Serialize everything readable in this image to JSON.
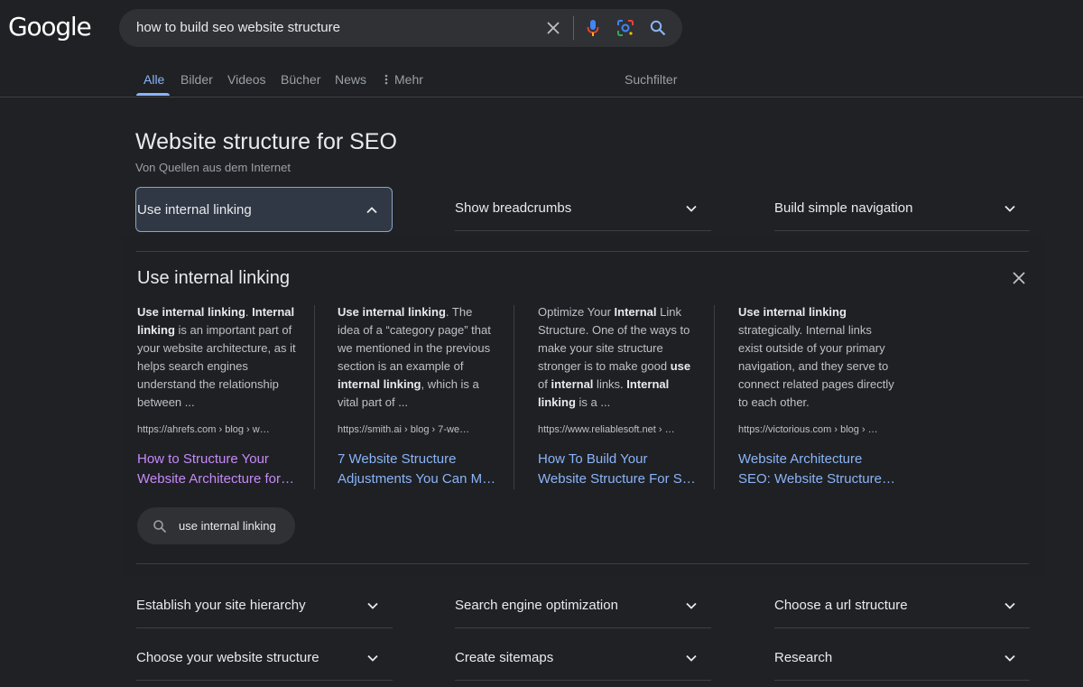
{
  "logo": "Google",
  "search": {
    "query": "how to build seo website structure"
  },
  "tabs": [
    {
      "label": "Alle",
      "active": true
    },
    {
      "label": "Bilder"
    },
    {
      "label": "Videos"
    },
    {
      "label": "Bücher"
    },
    {
      "label": "News"
    },
    {
      "label": "Mehr"
    }
  ],
  "search_tools": "Suchfilter",
  "panel": {
    "title": "Website structure for SEO",
    "subtitle": "Von Quellen aus dem Internet",
    "chips_top": [
      {
        "label": "Use internal linking",
        "expanded": true
      },
      {
        "label": "Show breadcrumbs"
      },
      {
        "label": "Build simple navigation"
      }
    ],
    "expanded": {
      "title": "Use internal linking",
      "sources": [
        {
          "url": "https://ahrefs.com › blog › w…",
          "link_line1": "How to Structure Your",
          "link_line2": "Website Architecture for…",
          "visited": true
        },
        {
          "url": "https://smith.ai › blog › 7-we…",
          "link_line1": "7 Website Structure",
          "link_line2": "Adjustments You Can M…"
        },
        {
          "url": "https://www.reliablesoft.net › …",
          "link_line1": "How To Build Your",
          "link_line2": "Website Structure For S…"
        },
        {
          "url": "https://victorious.com › blog › …",
          "link_line1": "Website Architecture",
          "link_line2": "SEO: Website Structure …"
        }
      ],
      "search_pill": "use internal linking"
    },
    "chips_bottom": [
      {
        "label": "Establish your site hierarchy"
      },
      {
        "label": "Search engine optimization"
      },
      {
        "label": "Choose a url structure"
      },
      {
        "label": "Choose your website structure"
      },
      {
        "label": "Create sitemaps"
      },
      {
        "label": "Research"
      }
    ]
  },
  "colors": {
    "background": "#202124",
    "link": "#8ab4f8",
    "visited": "#c58af9"
  }
}
